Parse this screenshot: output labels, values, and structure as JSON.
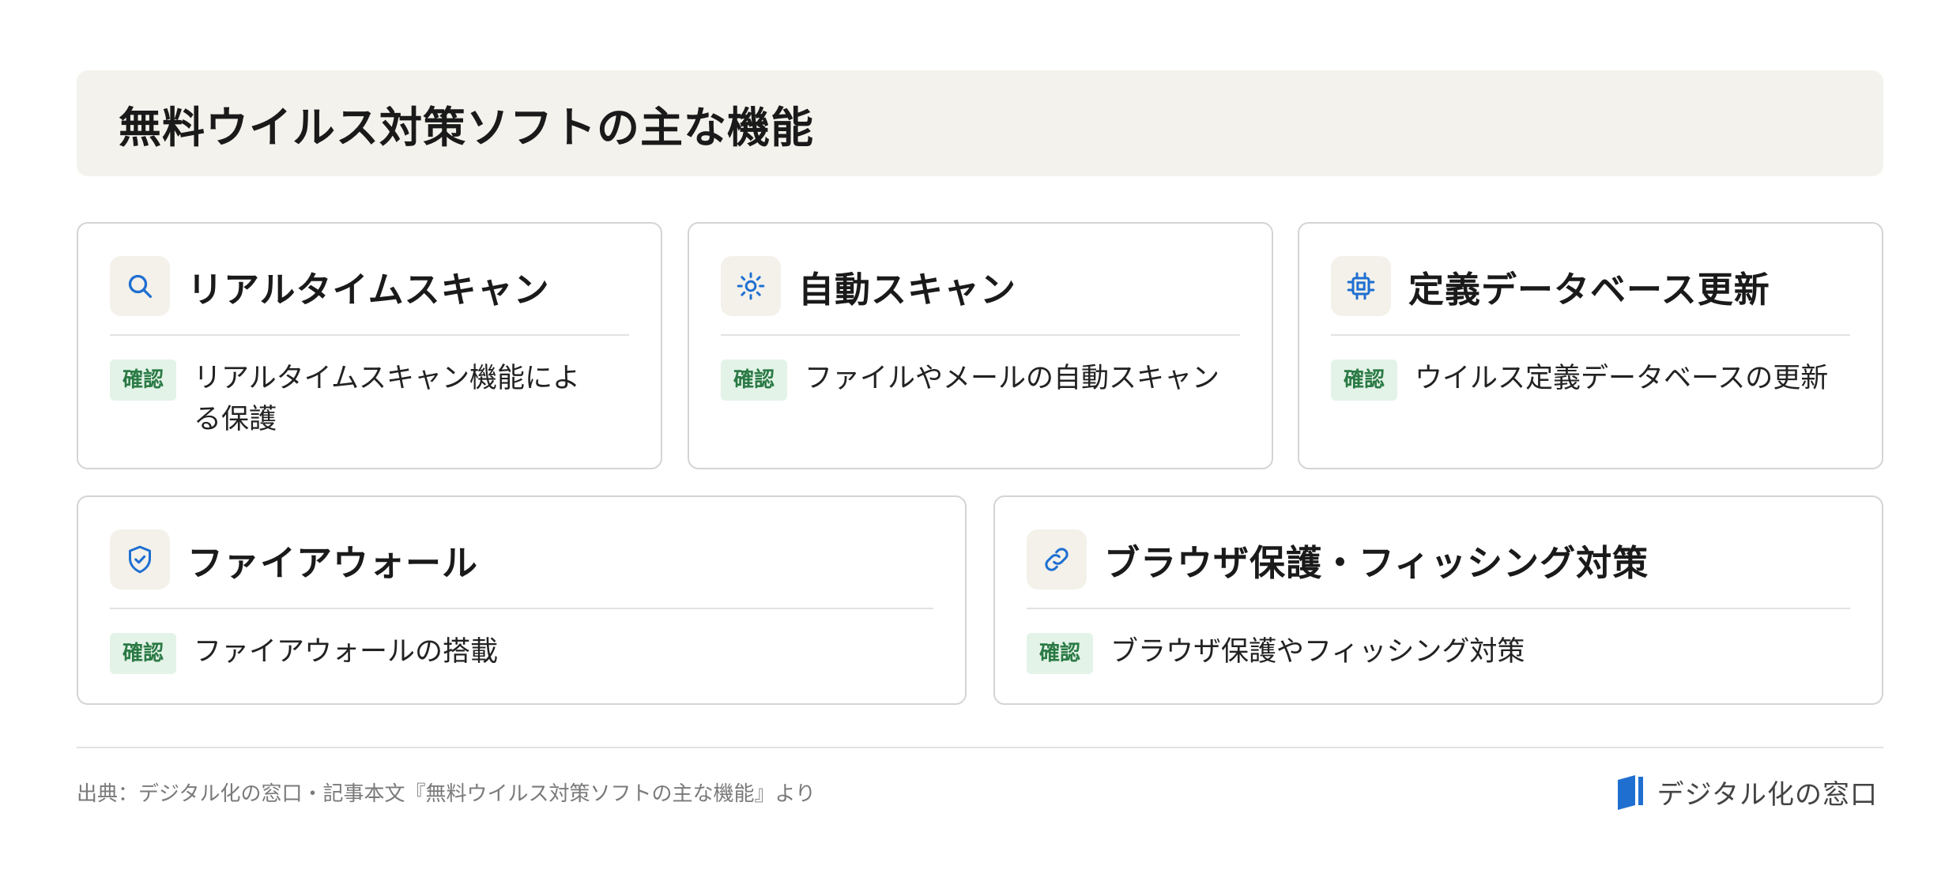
{
  "header": {
    "title": "無料ウイルス対策ソフトの主な機能"
  },
  "cards": [
    {
      "title": "リアルタイムスキャン",
      "icon": "search-icon",
      "badge": "確認",
      "text": "リアルタイムスキャン機能による保護"
    },
    {
      "title": "自動スキャン",
      "icon": "sun-icon",
      "badge": "確認",
      "text": "ファイルやメールの自動スキャン"
    },
    {
      "title": "定義データベース更新",
      "icon": "chip-icon",
      "badge": "確認",
      "text": "ウイルス定義データベースの更新"
    },
    {
      "title": "ファイアウォール",
      "icon": "shield-check-icon",
      "badge": "確認",
      "text": "ファイアウォールの搭載"
    },
    {
      "title": "ブラウザ保護・フィッシング対策",
      "icon": "link-icon",
      "badge": "確認",
      "text": "ブラウザ保護やフィッシング対策"
    }
  ],
  "footer": {
    "source": "出典：デジタル化の窓口・記事本文『無料ウイルス対策ソフトの主な機能』より",
    "brand": "デジタル化の窓口"
  },
  "colors": {
    "accent": "#1f6fd1",
    "badge_bg": "#e3f3e7",
    "badge_text": "#2b7a45",
    "header_bg": "#f4f2ec"
  }
}
